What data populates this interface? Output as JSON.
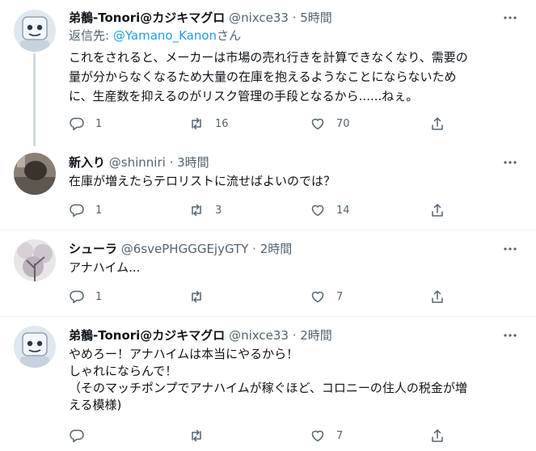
{
  "tweets": [
    {
      "name": "弟鶺-Tonori@カジキマグロ",
      "handle": "@nixce33",
      "time": "5時間",
      "reply_prefix": "返信先: ",
      "reply_to": "@Yamano_Kanon",
      "reply_suffix": "さん",
      "lines": [
        "これをされると、メーカーは市場の売れ行きを計算できなくなり、需要の",
        "量が分からなくなるため大量の在庫を抱えるようなことにならないため",
        "に、生産数を抑えるのがリスク管理の手段となるから......ねぇ。"
      ],
      "replies": "1",
      "retweets": "16",
      "likes": "70",
      "avatar_icon": "robot-avatar"
    },
    {
      "name": "新入り",
      "handle": "@shinniri",
      "time": "3時間",
      "lines": [
        "在庫が増えたらテロリストに流せばよいのでは？"
      ],
      "replies": "1",
      "retweets": "3",
      "likes": "14",
      "avatar_icon": "photo-avatar"
    },
    {
      "name": "シューラ",
      "handle": "@6svePHGGGEjyGTY",
      "time": "2時間",
      "lines": [
        "アナハイム..."
      ],
      "replies": "1",
      "retweets": "",
      "likes": "7",
      "avatar_icon": "cherry-blossom-avatar"
    },
    {
      "name": "弟鶺-Tonori@カジキマグロ",
      "handle": "@nixce33",
      "time": "2時間",
      "lines": [
        "やめろー！アナハイムは本当にやるから！",
        "しゃれにならんで！",
        "（そのマッチポンプでアナハイムが稼ぐほど、コロニーの住人の税金が増",
        "える模様)"
      ],
      "replies": "",
      "retweets": "",
      "likes": "7",
      "avatar_icon": "robot-avatar"
    }
  ],
  "separator": " · ",
  "colors": {
    "accent": "#1d9bf0",
    "secondary_text": "#536471",
    "thread_line": "#cfd9de"
  }
}
